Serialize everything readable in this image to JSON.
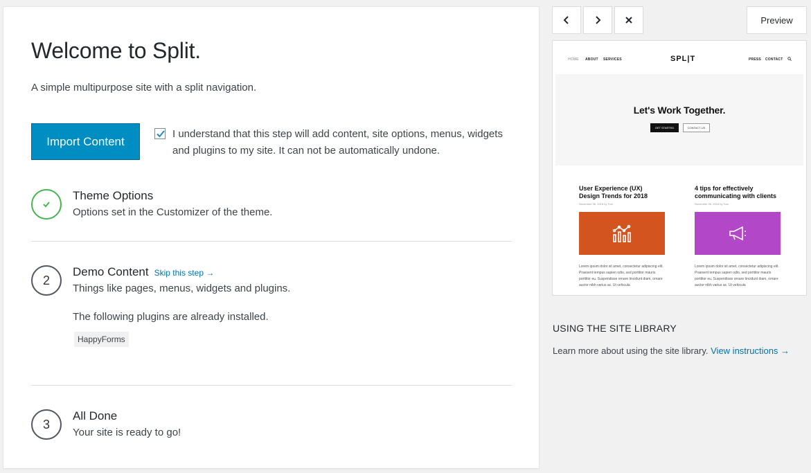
{
  "main": {
    "title": "Welcome to Split.",
    "subtitle": "A simple multipurpose site with a split navigation.",
    "import_button": "Import Content",
    "consent_checked": true,
    "consent_text": "I understand that this step will add content, site options, menus, widgets and plugins to my site. It can not be automatically undone.",
    "steps": [
      {
        "icon": "checkmark-icon",
        "title": "Theme Options",
        "description": "Options set in the Customizer of the theme."
      },
      {
        "number": "2",
        "title": "Demo Content",
        "skip_link": "Skip this step →",
        "description": "Things like pages, menus, widgets and plugins.",
        "plugins_note": "The following plugins are already installed.",
        "plugins": [
          "HappyForms"
        ]
      },
      {
        "number": "3",
        "title": "All Done",
        "description": "Your site is ready to go!"
      }
    ]
  },
  "sidebar": {
    "nav_icons": [
      "chevron-left-icon",
      "chevron-right-icon",
      "close-icon"
    ],
    "preview_button": "Preview",
    "thumbnail": {
      "nav_left": [
        "HOME",
        "ABOUT",
        "SERVICES"
      ],
      "logo": "SPL|T",
      "nav_right": [
        "PRESS",
        "CONTACT"
      ],
      "hero_title": "Let's Work Together.",
      "hero_primary": "GET STARTED",
      "hero_secondary": "CONTACT US",
      "posts": [
        {
          "title": "User Experience (UX) Design Trends for 2018",
          "meta": "November 06, 2018 by Tom",
          "color": "#d4541f",
          "icon": "chart-icon",
          "excerpt": "Lorem ipsum dolor sit amet, consectetur adipiscing elit. Praesent tempus sapien odio, sed porttitor mauris porttitor eu. Suspendisse ornare tincidunt diam, ornare auctor nibh varius ac. Ut vehicula"
        },
        {
          "title": "4 tips for effectively communicating with clients",
          "meta": "November 06, 2018 by Tom",
          "color": "#b247c8",
          "icon": "megaphone-icon",
          "excerpt": "Lorem ipsum dolor sit amet, consectetur adipiscing elit. Praesent tempus sapien odio, sed porttitor mauris porttitor eu. Suspendisse ornare tincidunt diam, ornare auctor nibh varius ac. Ut vehicula"
        }
      ]
    },
    "library_title": "USING THE SITE LIBRARY",
    "library_text": "Learn more about using the site library.",
    "library_link": "View instructions →"
  },
  "colors": {
    "primary": "#008ec2",
    "success": "#46b450",
    "link": "#0073aa"
  }
}
